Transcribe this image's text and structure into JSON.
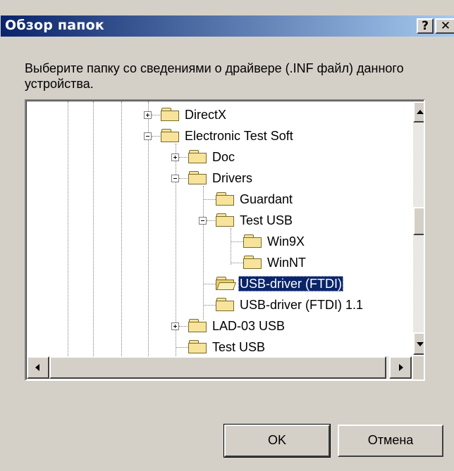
{
  "window": {
    "title": "Обзор папок",
    "help_button": "?",
    "close_button": "✕"
  },
  "prompt": "Выберите папку со сведениями о драйвере (.INF файл) данного устройства.",
  "tree": {
    "items": [
      {
        "label": "DirectX",
        "expander": "plus",
        "state": "closed"
      },
      {
        "label": "Electronic Test Soft",
        "expander": "minus",
        "state": "closed"
      },
      {
        "label": "Doc",
        "expander": "plus",
        "state": "closed"
      },
      {
        "label": "Drivers",
        "expander": "minus",
        "state": "closed"
      },
      {
        "label": "Guardant",
        "expander": "none",
        "state": "closed"
      },
      {
        "label": "Test USB",
        "expander": "minus",
        "state": "closed"
      },
      {
        "label": "Win9X",
        "expander": "none",
        "state": "closed"
      },
      {
        "label": "WinNT",
        "expander": "none",
        "state": "closed"
      },
      {
        "label": "USB-driver (FTDI)",
        "expander": "none",
        "state": "open",
        "selected": true
      },
      {
        "label": "USB-driver (FTDI) 1.1",
        "expander": "none",
        "state": "closed"
      },
      {
        "label": "LAD-03 USB",
        "expander": "plus",
        "state": "closed"
      },
      {
        "label": "Test USB",
        "expander": "none",
        "state": "closed"
      }
    ]
  },
  "buttons": {
    "ok": "OK",
    "cancel": "Отмена"
  },
  "colors": {
    "titlebar_start": "#0a246a",
    "titlebar_end": "#a6caf0",
    "selection": "#0a246a",
    "window_bg": "#d4d0c8"
  }
}
